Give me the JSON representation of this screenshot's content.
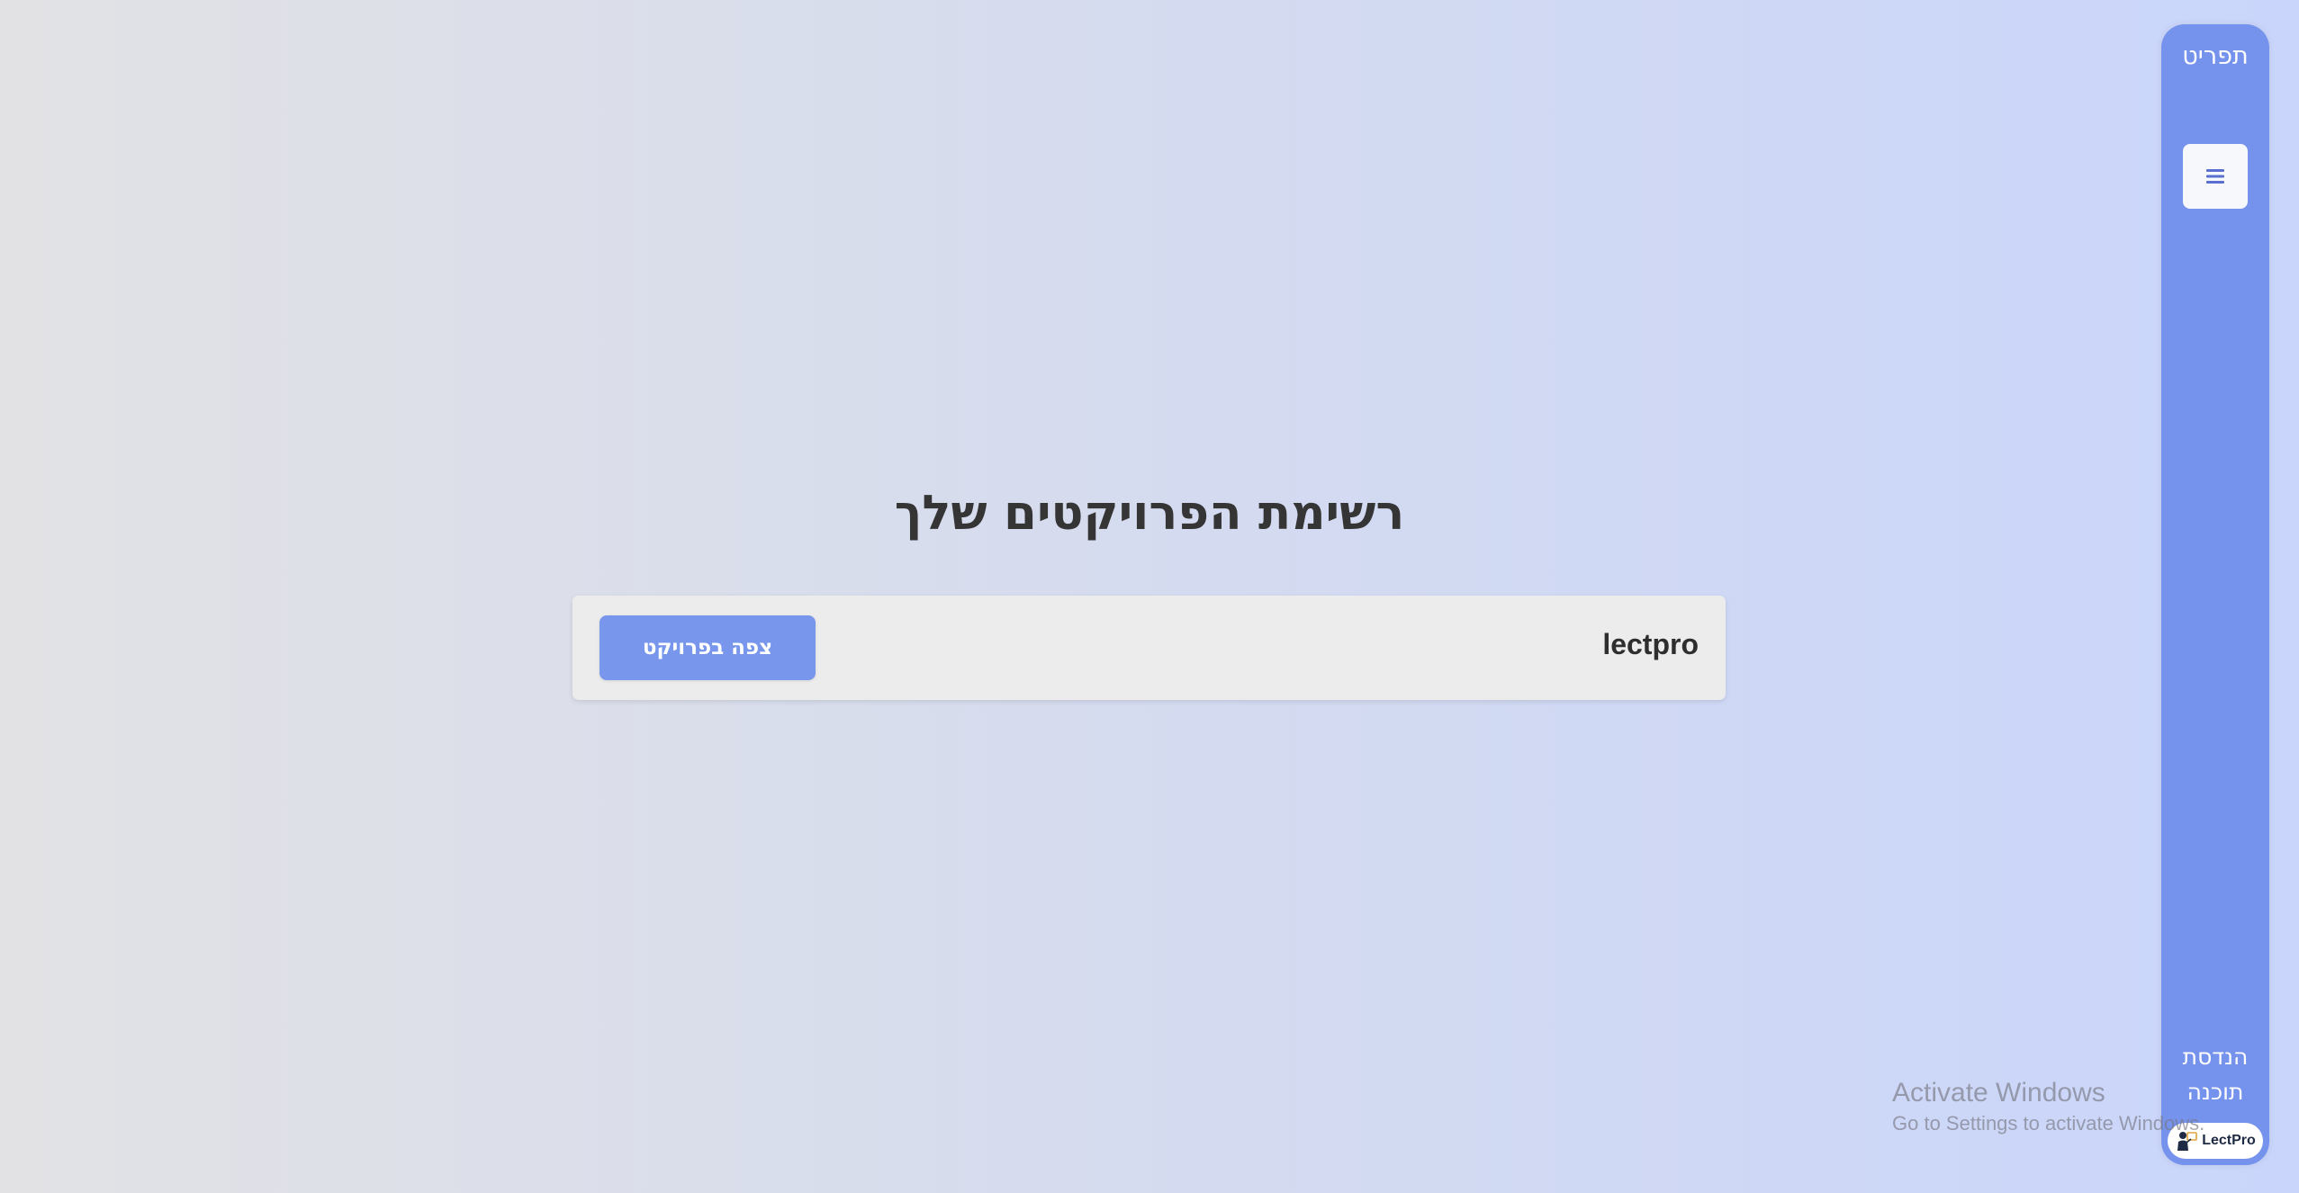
{
  "main": {
    "title": "רשימת הפרויקטים שלך",
    "projects": [
      {
        "name": "lectpro",
        "view_button_label": "צפה בפרויקט"
      }
    ]
  },
  "sidebar": {
    "title": "תפריט",
    "menu_icon": "hamburger-menu-icon",
    "footer_line1": "הנדסת",
    "footer_line2": "תוכנה",
    "logo_text": "LectPro"
  },
  "watermark": {
    "title": "Activate Windows",
    "subtitle": "Go to Settings to activate Windows."
  },
  "colors": {
    "accent": "#7592ec",
    "button": "#7796ec",
    "card": "#ececec",
    "text": "#353535"
  }
}
